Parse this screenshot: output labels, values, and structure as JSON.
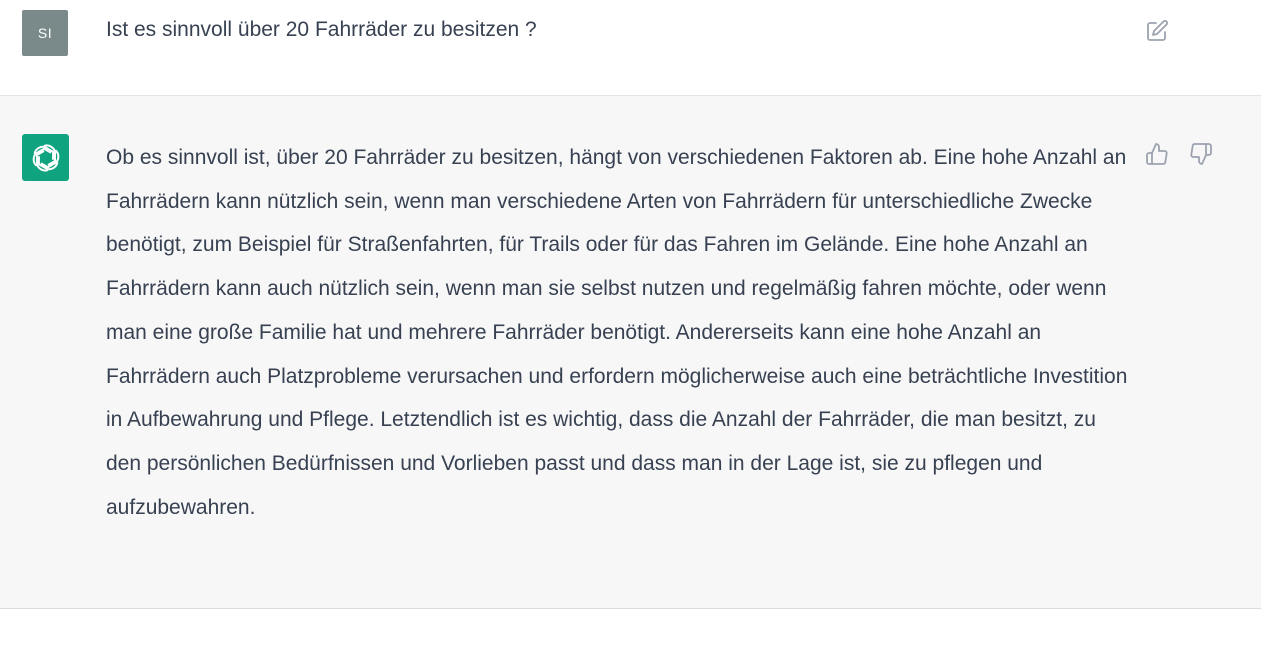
{
  "user_message": {
    "avatar_initials": "SI",
    "text": "Ist es sinnvoll über 20 Fahrräder zu besitzen ?",
    "edit_icon": "edit-icon"
  },
  "assistant_message": {
    "avatar_icon": "openai-logo-icon",
    "avatar_color": "#10a37f",
    "text": "Ob es sinnvoll ist, über 20 Fahrräder zu besitzen, hängt von verschiedenen Faktoren ab. Eine hohe Anzahl an Fahrrädern kann nützlich sein, wenn man verschiedene Arten von Fahrrädern für unterschiedliche Zwecke benötigt, zum Beispiel für Straßenfahrten, für Trails oder für das Fahren im Gelände. Eine hohe Anzahl an Fahrrädern kann auch nützlich sein, wenn man sie selbst nutzen und regelmäßig fahren möchte, oder wenn man eine große Familie hat und mehrere Fahrräder benötigt. Andererseits kann eine hohe Anzahl an Fahrrädern auch Platzprobleme verursachen und erfordern möglicherweise auch eine beträchtliche Investition in Aufbewahrung und Pflege. Letztendlich ist es wichtig, dass die Anzahl der Fahrräder, die man besitzt, zu den persönlichen Bedürfnissen und Vorlieben passt und dass man in der Lage ist, sie zu pflegen und aufzubewahren.",
    "feedback_icons": [
      "thumbs-up-icon",
      "thumbs-down-icon"
    ]
  }
}
